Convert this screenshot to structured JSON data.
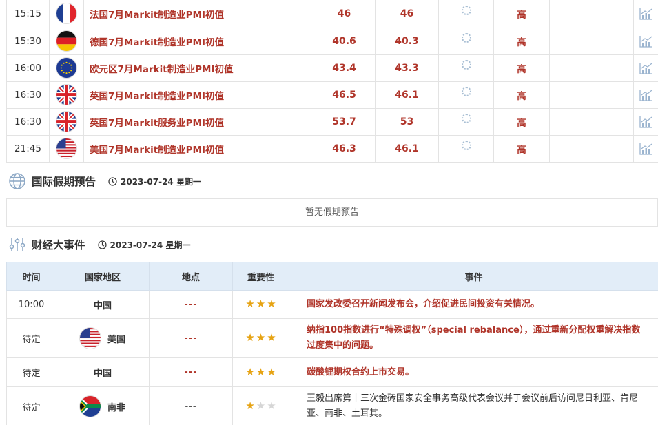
{
  "indicators": [
    {
      "time": "15:15",
      "flag": "france-flag-icon",
      "name": "法国7月Markit制造业PMI初值",
      "previous": "46",
      "forecast": "46",
      "level": "高"
    },
    {
      "time": "15:30",
      "flag": "germany-flag-icon",
      "name": "德国7月Markit制造业PMI初值",
      "previous": "40.6",
      "forecast": "40.3",
      "level": "高"
    },
    {
      "time": "16:00",
      "flag": "eu-flag-icon",
      "name": "欧元区7月Markit制造业PMI初值",
      "previous": "43.4",
      "forecast": "43.3",
      "level": "高"
    },
    {
      "time": "16:30",
      "flag": "uk-flag-icon",
      "name": "英国7月Markit制造业PMI初值",
      "previous": "46.5",
      "forecast": "46.1",
      "level": "高"
    },
    {
      "time": "16:30",
      "flag": "uk-flag-icon",
      "name": "英国7月Markit服务业PMI初值",
      "previous": "53.7",
      "forecast": "53",
      "level": "高"
    },
    {
      "time": "21:45",
      "flag": "us-flag-icon",
      "name": "美国7月Markit制造业PMI初值",
      "previous": "46.3",
      "forecast": "46.1",
      "level": "高"
    }
  ],
  "holiday": {
    "title": "国际假期预告",
    "date": "2023-07-24 星期一",
    "empty_text": "暂无假期预告"
  },
  "events": {
    "title": "财经大事件",
    "date": "2023-07-24 星期一",
    "headers": [
      "时间",
      "国家地区",
      "地点",
      "重要性",
      "事件"
    ],
    "rows": [
      {
        "time": "10:00",
        "country": "中国",
        "flag": "",
        "place": "---",
        "stars": 3,
        "text": "国家发改委召开新闻发布会，介绍促进民间投资有关情况。",
        "highlight": true
      },
      {
        "time": "待定",
        "country": "美国",
        "flag": "us-flag-icon",
        "place": "---",
        "stars": 3,
        "text": "纳指100指数进行“特殊调权”（special rebalance），通过重新分配权重解决指数过度集中的问题。",
        "highlight": true
      },
      {
        "time": "待定",
        "country": "中国",
        "flag": "",
        "place": "---",
        "stars": 3,
        "text": "碳酸锂期权合约上市交易。",
        "highlight": true
      },
      {
        "time": "待定",
        "country": "南非",
        "flag": "south-africa-flag-icon",
        "place": "---",
        "stars": 1,
        "text": "王毅出席第十三次金砖国家安全事务高级代表会议并于会议前后访问尼日利亚、肯尼亚、南非、土耳其。",
        "highlight": false
      }
    ]
  },
  "colors": {
    "accent_red": "#b0352a",
    "header_blue": "#e2edf8",
    "star_gold": "#e6a313"
  }
}
